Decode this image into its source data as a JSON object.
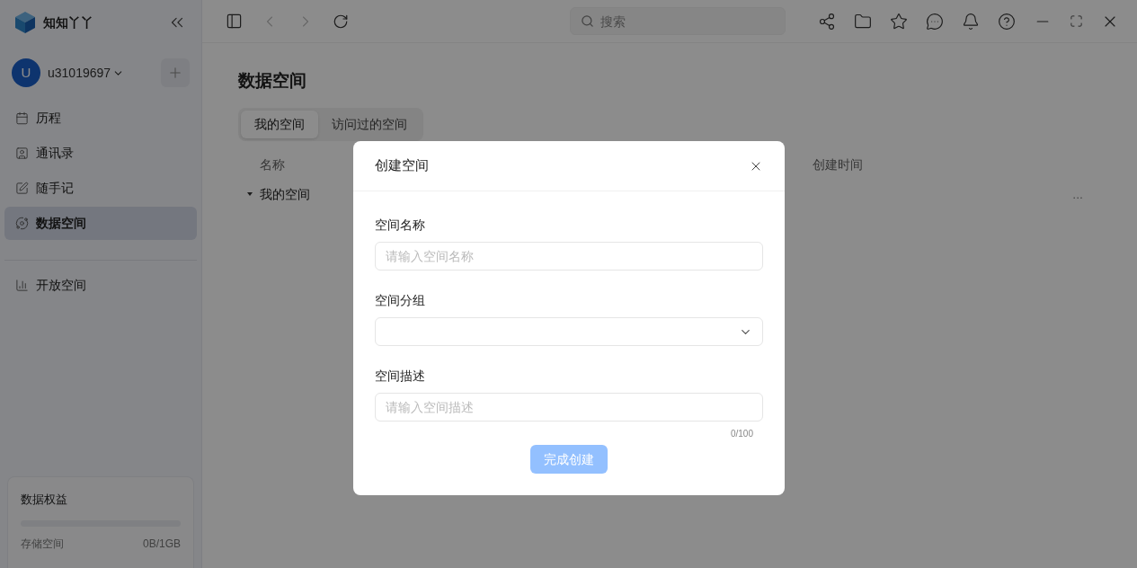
{
  "app": {
    "name": "知知丫丫"
  },
  "user": {
    "initial": "U",
    "name": "u31019697"
  },
  "sidebar": {
    "items": [
      {
        "label": "历程",
        "kind": "calendar",
        "selected": false
      },
      {
        "label": "通讯录",
        "kind": "contacts",
        "selected": false
      },
      {
        "label": "随手记",
        "kind": "note",
        "selected": false
      },
      {
        "label": "数据空间",
        "kind": "space",
        "selected": true
      }
    ],
    "secondary_items": [
      {
        "label": "开放空间",
        "kind": "chart",
        "selected": false
      }
    ]
  },
  "quota": {
    "title": "数据权益",
    "level": 0,
    "label": "存储空间",
    "value": "0B/1GB"
  },
  "toolbar": {
    "search": {
      "placeholder": "搜索"
    }
  },
  "page": {
    "title": "数据空间",
    "tabs": [
      {
        "label": "我的空间",
        "selected": true
      },
      {
        "label": "访问过的空间",
        "selected": false
      }
    ],
    "table": {
      "columns": [
        "名称",
        "创建时间"
      ],
      "rows": [
        {
          "name": "我的空间",
          "expanded": true,
          "more": "..."
        }
      ]
    }
  },
  "dialog": {
    "title": "创建空间",
    "fields": [
      {
        "label": "空间名称",
        "kind": "text",
        "placeholder": "请输入空间名称"
      },
      {
        "label": "空间分组",
        "kind": "select"
      },
      {
        "label": "空间描述",
        "kind": "text",
        "placeholder": "请输入空间描述",
        "counter": "0/100"
      }
    ],
    "submit": {
      "label": "完成创建",
      "disabled": true
    }
  }
}
